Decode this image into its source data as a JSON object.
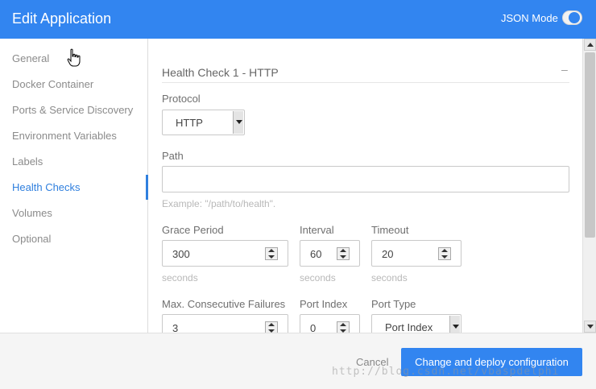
{
  "header": {
    "title": "Edit Application",
    "json_mode_label": "JSON Mode"
  },
  "sidebar": {
    "items": [
      {
        "label": "General"
      },
      {
        "label": "Docker Container"
      },
      {
        "label": "Ports & Service Discovery"
      },
      {
        "label": "Environment Variables"
      },
      {
        "label": "Labels"
      },
      {
        "label": "Health Checks",
        "active": true
      },
      {
        "label": "Volumes"
      },
      {
        "label": "Optional"
      }
    ]
  },
  "health_check": {
    "section_title": "Health Check 1 - HTTP",
    "collapse_symbol": "–",
    "protocol": {
      "label": "Protocol",
      "value": "HTTP"
    },
    "path": {
      "label": "Path",
      "value": "",
      "hint": "Example: \"/path/to/health\"."
    },
    "grace_period": {
      "label": "Grace Period",
      "value": "300",
      "unit": "seconds"
    },
    "interval": {
      "label": "Interval",
      "value": "60",
      "unit": "seconds"
    },
    "timeout": {
      "label": "Timeout",
      "value": "20",
      "unit": "seconds"
    },
    "max_failures": {
      "label": "Max. Consecutive Failures",
      "value": "3"
    },
    "port_index": {
      "label": "Port Index",
      "value": "0"
    },
    "port_type": {
      "label": "Port Type",
      "value": "Port Index"
    }
  },
  "footer": {
    "cancel_label": "Cancel",
    "deploy_label": "Change and deploy configuration"
  },
  "watermark": "http://blog.csdn.net/vbaspdelphi",
  "colors": {
    "accent": "#3285f0",
    "active_nav": "#2f7fde"
  }
}
